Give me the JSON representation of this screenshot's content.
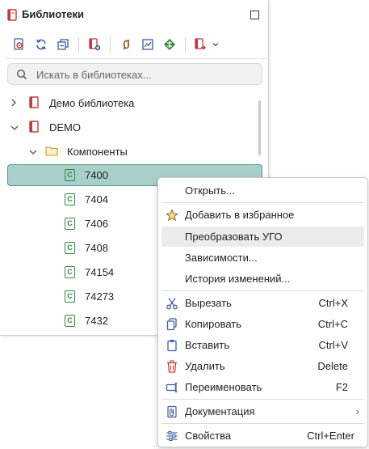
{
  "panel": {
    "title": "Библиотеки",
    "title_icon": "library-book-icon",
    "toolbar": [
      {
        "name": "open-library-icon"
      },
      {
        "name": "refresh-icon"
      },
      {
        "name": "collapse-all-icon"
      },
      {
        "name": "new-library-icon"
      },
      {
        "name": "link-icon"
      },
      {
        "name": "image-icon"
      },
      {
        "name": "component-diamond-icon"
      },
      {
        "name": "import-icon"
      },
      {
        "name": "dropdown-chevron-icon"
      }
    ],
    "search": {
      "placeholder": "Искать в библиотеках..."
    }
  },
  "tree": [
    {
      "label": "Демо библиотека",
      "expanded": false,
      "level": 0,
      "type": "library"
    },
    {
      "label": "DEMO",
      "expanded": true,
      "level": 0,
      "type": "library"
    },
    {
      "label": "Компоненты",
      "expanded": true,
      "level": 1,
      "type": "folder"
    },
    {
      "label": "7400",
      "level": 2,
      "type": "component",
      "selected": true,
      "icon_letter": "C"
    },
    {
      "label": "7404",
      "level": 2,
      "type": "component",
      "icon_letter": "C"
    },
    {
      "label": "7406",
      "level": 2,
      "type": "component",
      "icon_letter": "C"
    },
    {
      "label": "7408",
      "level": 2,
      "type": "component",
      "icon_letter": "C"
    },
    {
      "label": "74154",
      "level": 2,
      "type": "component",
      "icon_letter": "C"
    },
    {
      "label": "74273",
      "level": 2,
      "type": "component",
      "icon_letter": "C"
    },
    {
      "label": "7432",
      "level": 2,
      "type": "component",
      "icon_letter": "C"
    }
  ],
  "context_menu": {
    "items": [
      {
        "label": "Открыть...",
        "icon": ""
      },
      {
        "label": "Добавить в избранное",
        "icon": "star-icon"
      },
      {
        "label": "Преобразовать УГО",
        "icon": "",
        "hover": true
      },
      {
        "label": "Зависимости...",
        "icon": ""
      },
      {
        "label": "История изменений...",
        "icon": ""
      },
      {
        "label": "Вырезать",
        "icon": "scissors-icon",
        "shortcut": "Ctrl+X"
      },
      {
        "label": "Копировать",
        "icon": "copy-icon",
        "shortcut": "Ctrl+C"
      },
      {
        "label": "Вставить",
        "icon": "paste-icon",
        "shortcut": "Ctrl+V"
      },
      {
        "label": "Удалить",
        "icon": "trash-icon",
        "shortcut": "Delete"
      },
      {
        "label": "Переименовать",
        "icon": "rename-icon",
        "shortcut": "F2"
      },
      {
        "label": "Документация",
        "icon": "attachment-icon",
        "submenu": true
      },
      {
        "label": "Свойства",
        "icon": "properties-icon",
        "shortcut": "Ctrl+Enter"
      }
    ],
    "submenu_arrow": "›"
  },
  "colors": {
    "selection": "#a8cfc9",
    "selection_border": "#5a9a91",
    "library_red": "#c8383d",
    "component_green": "#2f8a3f",
    "folder_yellow": "#e3b54a"
  }
}
